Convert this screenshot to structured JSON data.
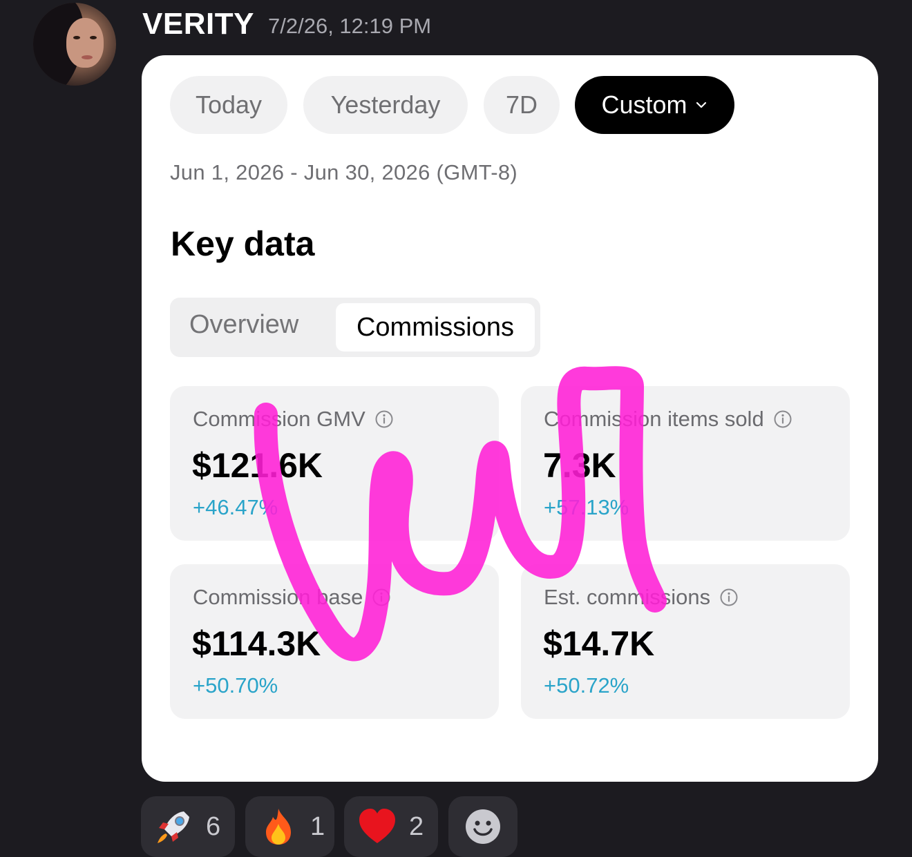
{
  "message": {
    "username": "VERITY",
    "timestamp": "7/2/26, 12:19 PM"
  },
  "period_chips": [
    {
      "label": "Today",
      "selected": false
    },
    {
      "label": "Yesterday",
      "selected": false
    },
    {
      "label": "7D",
      "selected": false
    },
    {
      "label": "Custom",
      "selected": true
    }
  ],
  "date_range": "Jun 1, 2026 - Jun 30, 2026 (GMT-8)",
  "section_title": "Key data",
  "segment_tabs": [
    {
      "label": "Overview",
      "selected": false
    },
    {
      "label": "Commissions",
      "selected": true
    }
  ],
  "metrics": [
    {
      "label": "Commission GMV",
      "value": "$121.6K",
      "delta": "+46.47%"
    },
    {
      "label": "Commission items sold",
      "value": "7.3K",
      "delta": "+57.13%"
    },
    {
      "label": "Commission base",
      "value": "$114.3K",
      "delta": "+50.70%"
    },
    {
      "label": "Est. commissions",
      "value": "$14.7K",
      "delta": "+50.72%"
    }
  ],
  "reactions": [
    {
      "icon": "rocket-icon",
      "count": "6"
    },
    {
      "icon": "fire-icon",
      "count": "1"
    },
    {
      "icon": "heart-icon",
      "count": "2"
    },
    {
      "icon": "add-reaction-smiley-icon"
    }
  ],
  "colors": {
    "background": "#1c1b20",
    "card": "#ffffff",
    "delta_positive": "#2aa4c9",
    "scribble": "#ff1fd6"
  }
}
